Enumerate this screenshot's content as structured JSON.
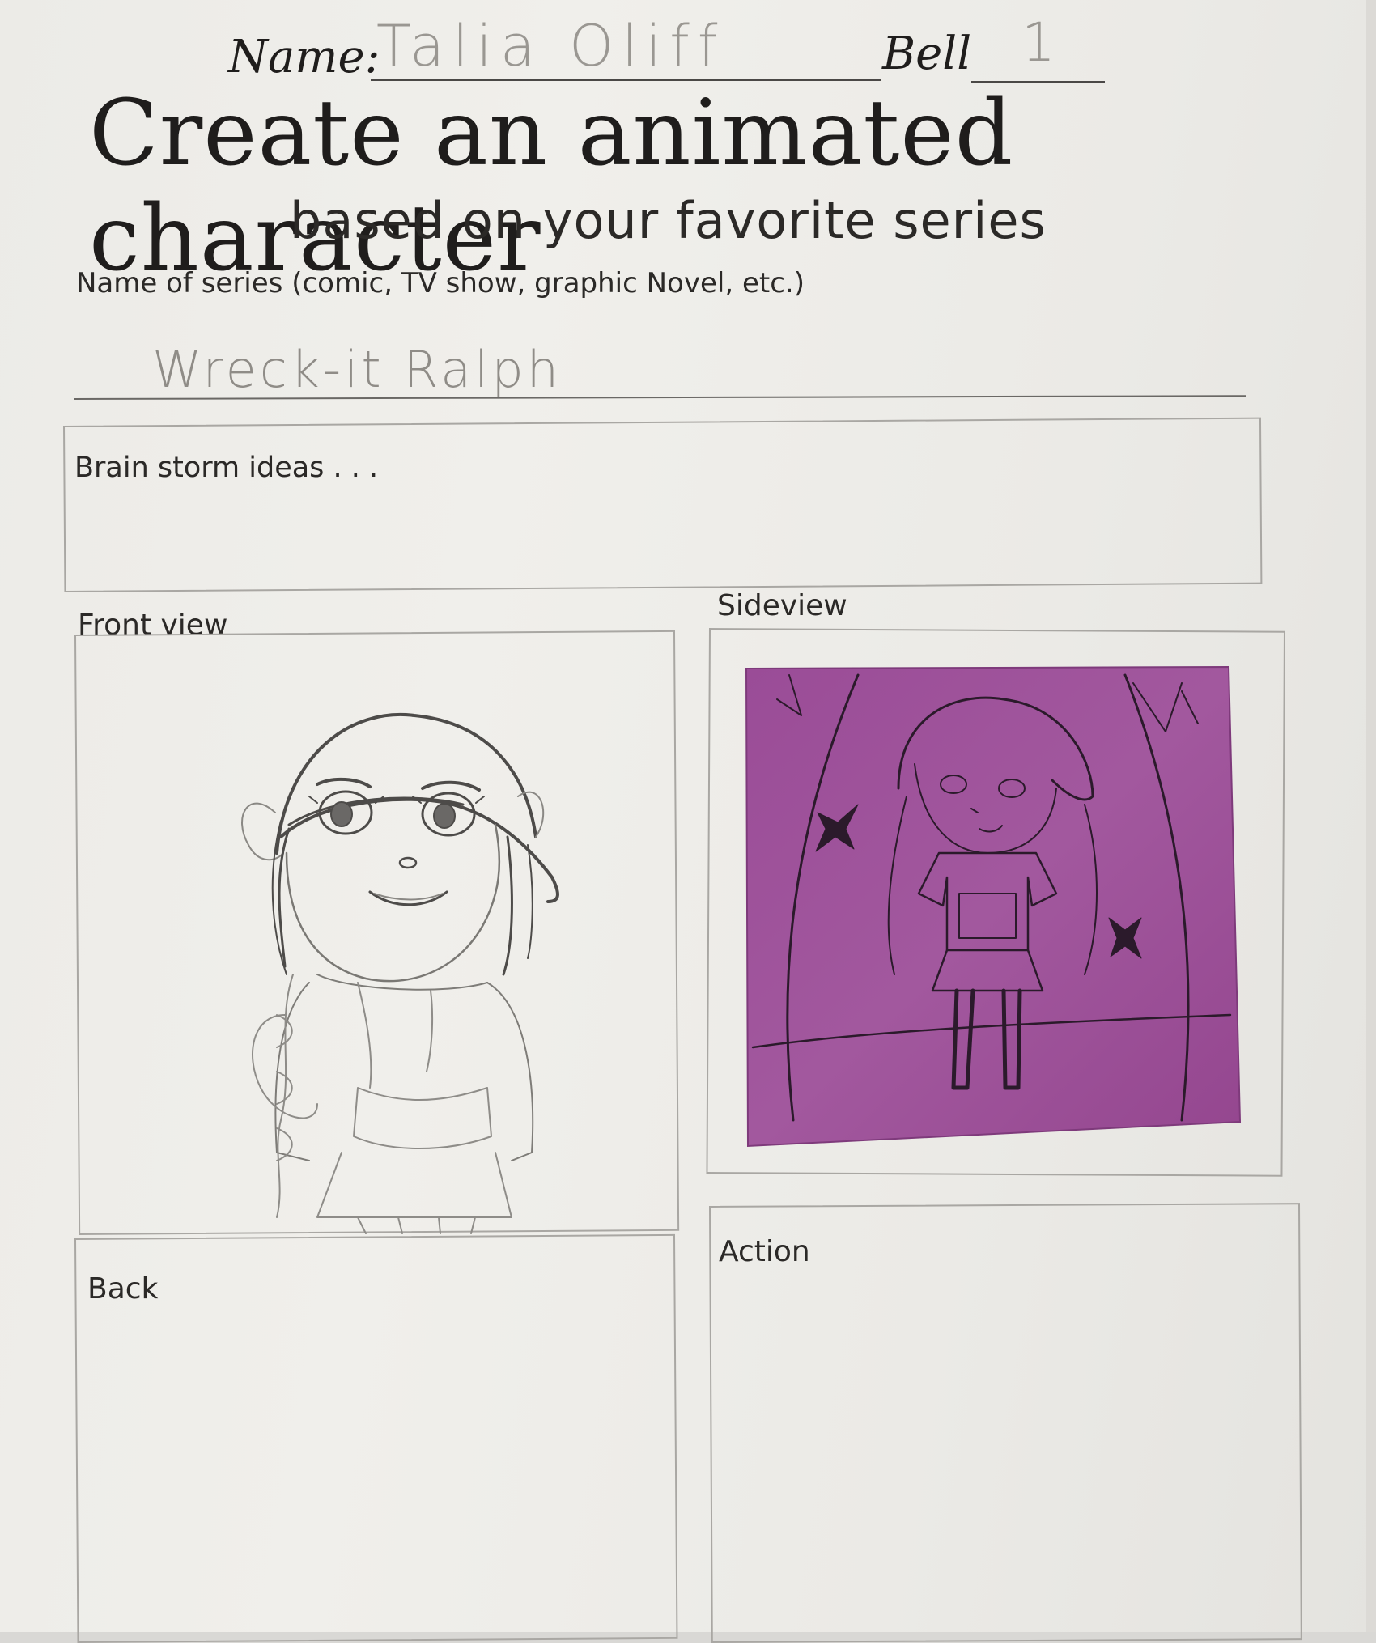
{
  "header": {
    "name_label": "Name:",
    "name_value": "Talia Oliff",
    "bell_label": "Bell",
    "bell_value": "1"
  },
  "title": "Create an animated character",
  "subtitle": "based on your favorite series",
  "series": {
    "prompt": "Name of series (comic, TV show, graphic Novel, etc.)",
    "answer": "Wreck-it Ralph"
  },
  "brainstorm": {
    "label": "Brain storm ideas . . ."
  },
  "panels": {
    "front": {
      "label": "Front view"
    },
    "side": {
      "label": "Sideview",
      "note_color": "#9c4f98"
    },
    "back": {
      "label": "Back"
    },
    "action": {
      "label": "Action"
    }
  }
}
